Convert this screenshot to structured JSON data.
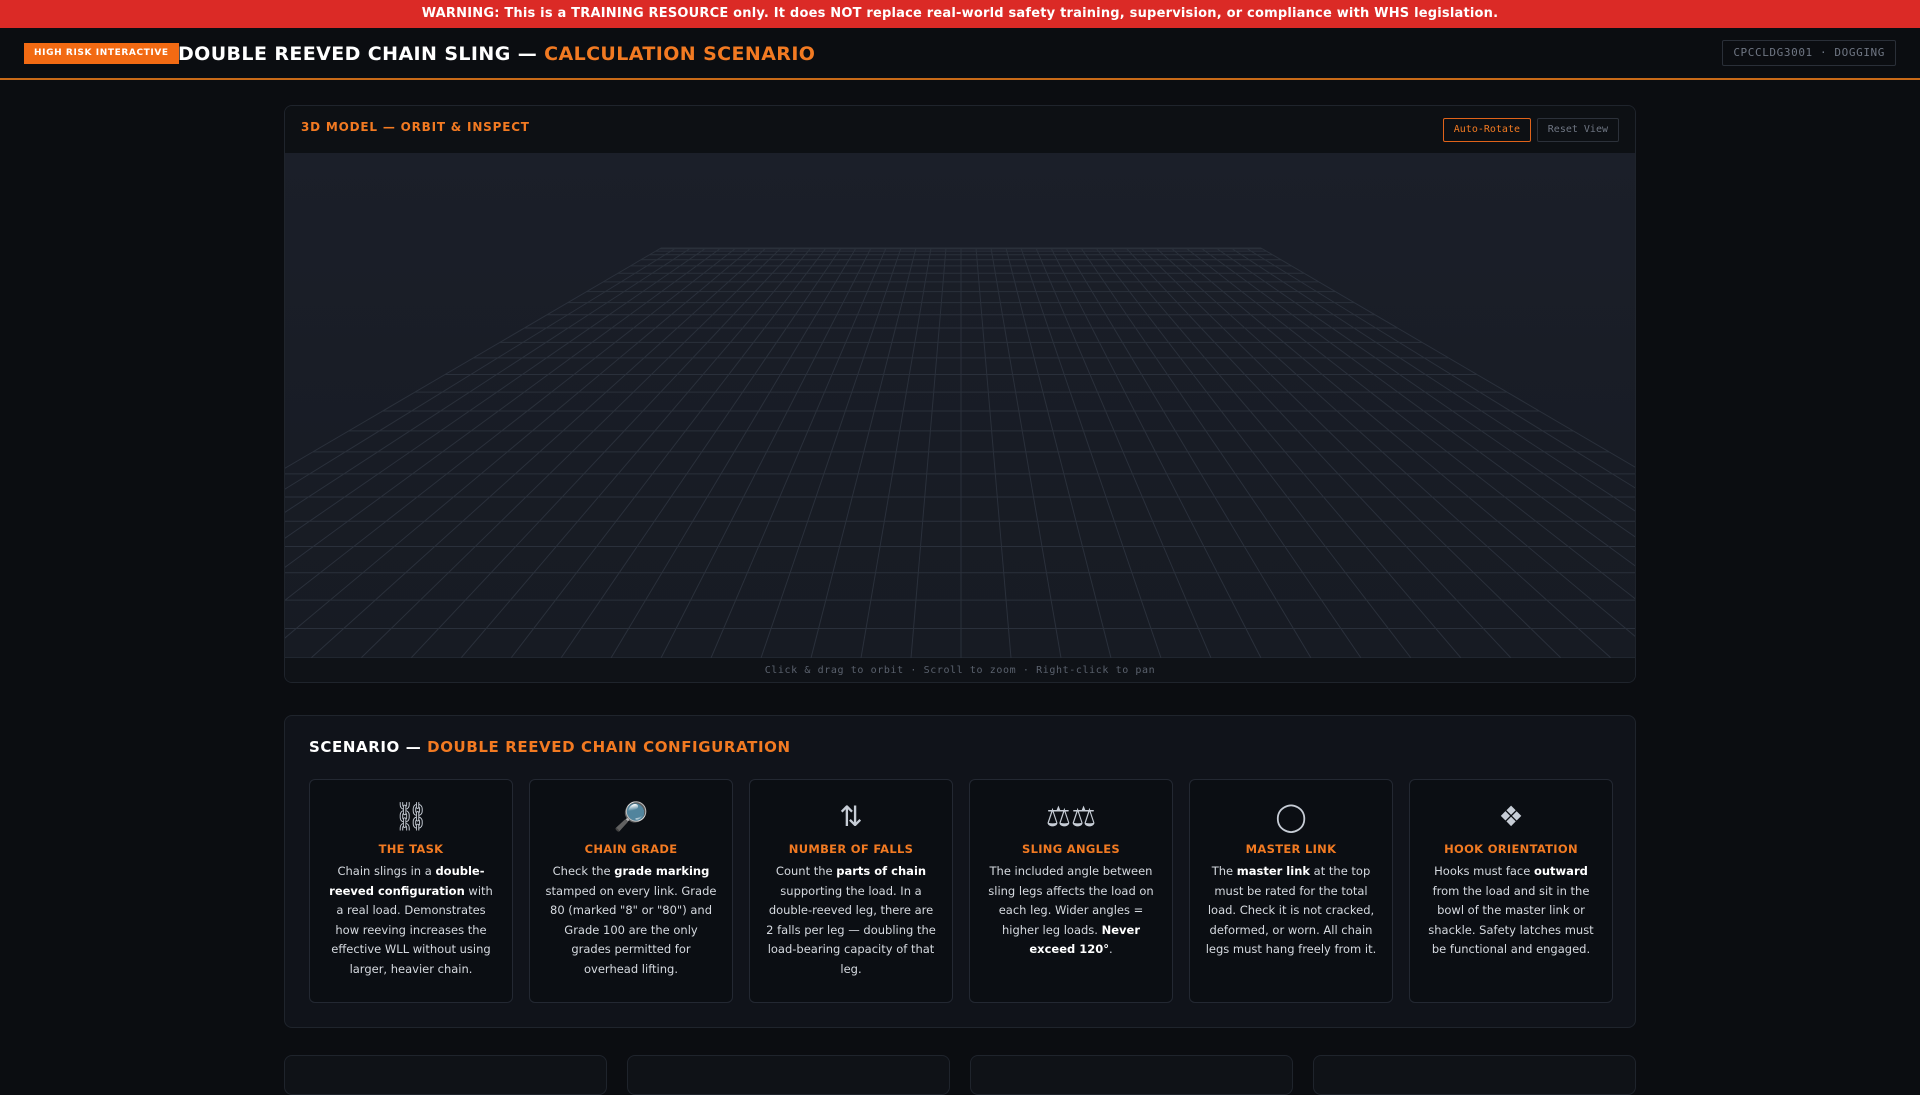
{
  "warning": "WARNING: This is a TRAINING RESOURCE only. It does NOT replace real-world safety training, supervision, or compliance with WHS legislation.",
  "header": {
    "badge": "HIGH RISK INTERACTIVE",
    "title_main": "DOUBLE REEVED CHAIN SLING — ",
    "title_accent": "CALCULATION SCENARIO",
    "course_code": "CPCCLDG3001 · DOGGING"
  },
  "model_panel": {
    "title": "3D MODEL — ORBIT & INSPECT",
    "auto_rotate_label": "Auto-Rotate",
    "reset_view_label": "Reset View",
    "hint": "Click & drag to orbit · Scroll to zoom · Right-click to pan"
  },
  "scenario": {
    "title_main": "SCENARIO — ",
    "title_accent": "DOUBLE REEVED CHAIN CONFIGURATION",
    "cards": [
      {
        "icon": "chain-icon",
        "glyph": "⛓",
        "title": "THE TASK",
        "parts": [
          {
            "t": "Chain slings in a ",
            "b": false
          },
          {
            "t": "double-reeved configuration",
            "b": true
          },
          {
            "t": " with a real load. Demonstrates how reeving increases the effective WLL without using larger, heavier chain.",
            "b": false
          }
        ]
      },
      {
        "icon": "magnifier-icon",
        "glyph": "🔎",
        "title": "CHAIN GRADE",
        "parts": [
          {
            "t": "Check the ",
            "b": false
          },
          {
            "t": "grade marking",
            "b": true
          },
          {
            "t": " stamped on every link. Grade 80 (marked \"8\" or \"80\") and Grade 100 are the only grades permitted for overhead lifting.",
            "b": false
          }
        ]
      },
      {
        "icon": "up-down-arrows-icon",
        "glyph": "⇅",
        "title": "NUMBER OF FALLS",
        "parts": [
          {
            "t": "Count the ",
            "b": false
          },
          {
            "t": "parts of chain",
            "b": true
          },
          {
            "t": " supporting the load. In a double-reeved leg, there are 2 falls per leg — doubling the load-bearing capacity of that leg.",
            "b": false
          }
        ]
      },
      {
        "icon": "scales-icon",
        "glyph": "⚖⚖",
        "title": "SLING ANGLES",
        "parts": [
          {
            "t": "The included angle between sling legs affects the load on each leg. Wider angles = higher leg loads. ",
            "b": false
          },
          {
            "t": "Never exceed 120°",
            "b": true
          },
          {
            "t": ".",
            "b": false
          }
        ]
      },
      {
        "icon": "ring-icon",
        "glyph": "◯",
        "title": "MASTER LINK",
        "parts": [
          {
            "t": "The ",
            "b": false
          },
          {
            "t": "master link",
            "b": true
          },
          {
            "t": " at the top must be rated for the total load. Check it is not cracked, deformed, or worn. All chain legs must hang freely from it.",
            "b": false
          }
        ]
      },
      {
        "icon": "hook-diamond-icon",
        "glyph": "❖",
        "title": "HOOK ORIENTATION",
        "parts": [
          {
            "t": "Hooks must face ",
            "b": false
          },
          {
            "t": "outward",
            "b": true
          },
          {
            "t": " from the load and sit in the bowl of the master link or shackle. Safety latches must be functional and engaged.",
            "b": false
          }
        ]
      }
    ]
  },
  "colors": {
    "warning_bg": "#db2a26",
    "accent": "#f27a22",
    "badge_bg": "#f26a13",
    "page_bg": "#0b0d11"
  }
}
